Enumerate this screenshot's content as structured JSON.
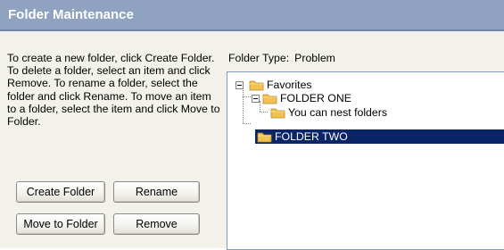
{
  "window": {
    "title": "Folder Maintenance"
  },
  "instructions": "To create a new folder, click Create Folder. To delete a folder, select an item and click Remove. To rename a folder, select the folder and click Rename. To move an item to a folder, select the item and click Move to Folder.",
  "buttons": {
    "create_folder": "Create Folder",
    "rename": "Rename",
    "move_to_folder": "Move to Folder",
    "remove": "Remove"
  },
  "folder_type": {
    "label": "Folder Type:",
    "value": "Problem"
  },
  "tree": {
    "items": [
      {
        "label": "Favorites",
        "expanded": true,
        "selected": false
      },
      {
        "label": "FOLDER ONE",
        "expanded": true,
        "selected": false
      },
      {
        "label": "You can nest folders",
        "selected": false
      },
      {
        "label": "FOLDER TWO",
        "selected": true
      }
    ]
  },
  "colors": {
    "title_bar": "#8fa3c0",
    "panel": "#f2f1ea",
    "selection": "#0a246a",
    "folder": "#f2c14e"
  },
  "icons": [
    "expander-minus-icon",
    "folder-icon"
  ]
}
